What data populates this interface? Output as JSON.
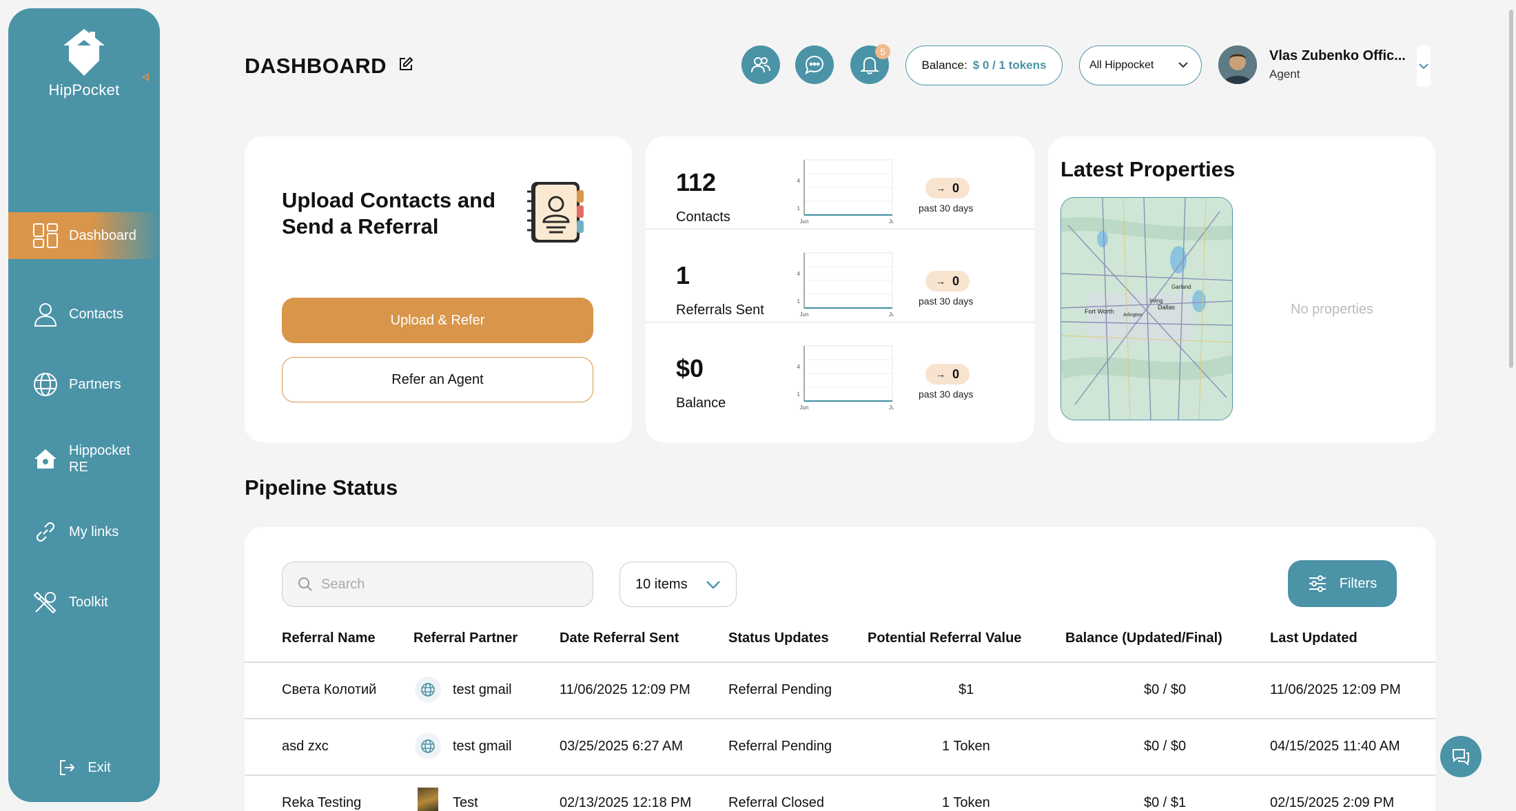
{
  "sidebar": {
    "logo_text": "HipPocket",
    "items": [
      {
        "label": "Dashboard",
        "icon": "dashboard-icon"
      },
      {
        "label": "Contacts",
        "icon": "user-icon"
      },
      {
        "label": "Partners",
        "icon": "globe-icon"
      },
      {
        "label": "Hippocket RE",
        "icon": "house-icon"
      },
      {
        "label": "My links",
        "icon": "link-icon"
      },
      {
        "label": "Toolkit",
        "icon": "tools-icon"
      }
    ],
    "exit_label": "Exit",
    "active_color": "#d9954a",
    "bg_color": "#4b93a7"
  },
  "header": {
    "title": "DASHBOARD",
    "notifications_count": "5",
    "balance_label": "Balance:",
    "balance_value": "$ 0 / 1 tokens",
    "scope_select": "All Hippocket",
    "user_name": "Vlas Zubenko Offic...",
    "user_role": "Agent"
  },
  "upload_card": {
    "title": "Upload Contacts and Send a Referral",
    "primary_button": "Upload & Refer",
    "secondary_button": "Refer an Agent"
  },
  "stats": [
    {
      "value": "112",
      "label": "Contacts",
      "trend": "0",
      "period": "past 30 days"
    },
    {
      "value": "1",
      "label": "Referrals Sent",
      "trend": "0",
      "period": "past 30 days"
    },
    {
      "value": "$0",
      "label": "Balance",
      "trend": "0",
      "period": "past 30 days"
    }
  ],
  "mini_chart": {
    "y_ticks": [
      "4",
      "1"
    ],
    "x_ticks": [
      "Jun",
      "Jul"
    ]
  },
  "properties": {
    "title": "Latest Properties",
    "empty_text": "No properties",
    "map_labels": [
      "Fort Worth",
      "Irving",
      "Garland",
      "Dallas",
      "Arlington"
    ]
  },
  "pipeline": {
    "title": "Pipeline Status",
    "search_placeholder": "Search",
    "page_size": "10 items",
    "filters_label": "Filters",
    "columns": [
      "Referral Name",
      "Referral Partner",
      "Date Referral Sent",
      "Status Updates",
      "Potential Referral Value",
      "Balance (Updated/Final)",
      "Last Updated"
    ],
    "rows": [
      {
        "name": "Света Колотий",
        "partner": "test gmail",
        "date": "11/06/2025 12:09 PM",
        "status": "Referral Pending",
        "value": "$1",
        "balance": "$0 / $0",
        "updated": "11/06/2025 12:09 PM"
      },
      {
        "name": "asd zxc",
        "partner": "test gmail",
        "date": "03/25/2025 6:27 AM",
        "status": "Referral Pending",
        "value": "1 Token",
        "balance": "$0 / $0",
        "updated": "04/15/2025 11:40 AM"
      },
      {
        "name": "Reka Testing",
        "partner": "Test",
        "date": "02/13/2025 12:18 PM",
        "status": "Referral Closed",
        "value": "1 Token",
        "balance": "$0 / $1",
        "updated": "02/15/2025 2:09 PM"
      }
    ]
  }
}
